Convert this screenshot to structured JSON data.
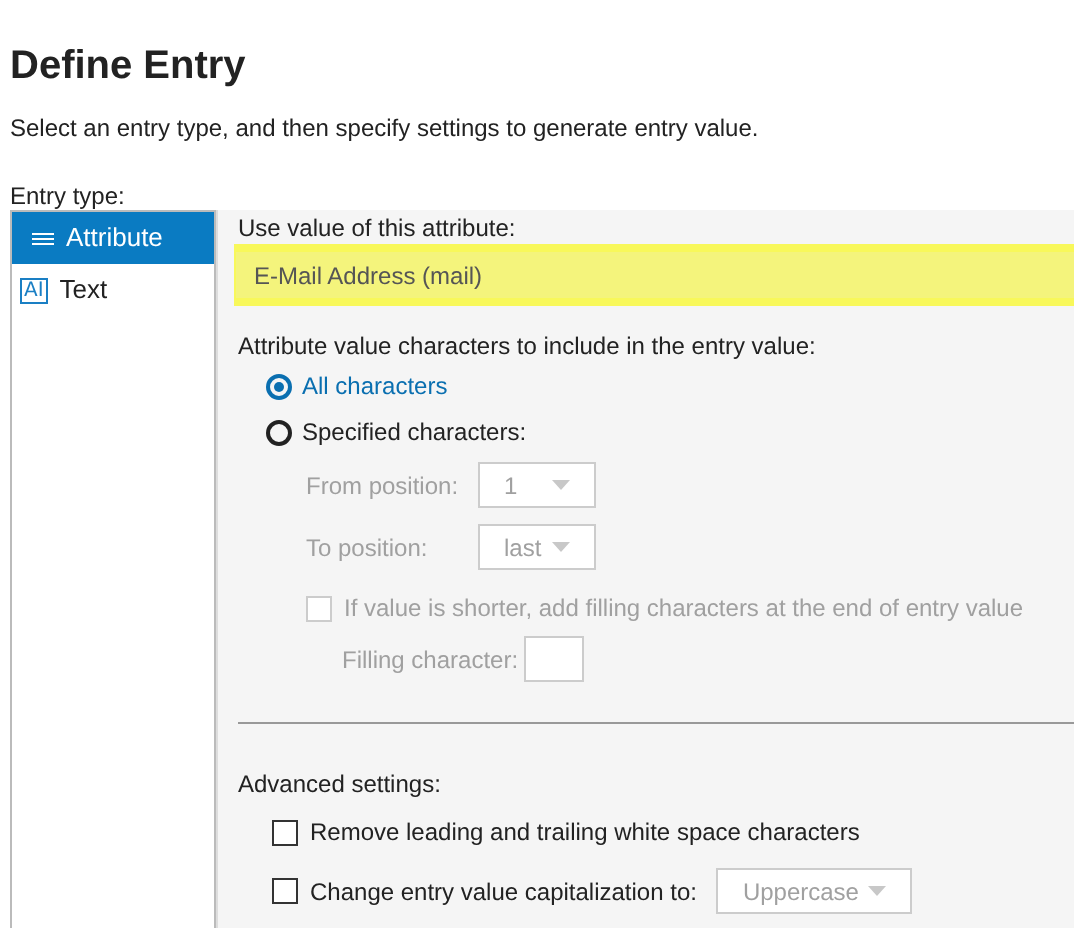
{
  "title": "Define Entry",
  "subtitle": "Select an entry type, and then specify settings to generate entry value.",
  "entry_type": {
    "label": "Entry type:",
    "items": [
      {
        "label": "Attribute",
        "kind": "attribute",
        "selected": true
      },
      {
        "label": "Text",
        "kind": "text",
        "selected": false,
        "icon_text": "AI"
      }
    ]
  },
  "attribute": {
    "label": "Use value of this attribute:",
    "value": "E-Mail Address (mail)",
    "highlighted": true
  },
  "characters": {
    "label": "Attribute value characters to include in the entry value:",
    "options": [
      {
        "label": "All characters",
        "selected": true
      },
      {
        "label": "Specified characters:",
        "selected": false
      }
    ],
    "from": {
      "label": "From position:",
      "value": "1",
      "disabled": true
    },
    "to": {
      "label": "To position:",
      "value": "last",
      "disabled": true
    },
    "fill": {
      "label": "If value is shorter, add filling characters at the end of entry value",
      "checked": false,
      "disabled": true
    },
    "fill_char": {
      "label": "Filling character:",
      "disabled": true
    }
  },
  "advanced": {
    "label": "Advanced settings:",
    "trim": {
      "label": "Remove leading and trailing white space characters",
      "checked": false
    },
    "caps": {
      "label": "Change entry value capitalization to:",
      "checked": false,
      "value": "Uppercase",
      "disabled": true
    }
  }
}
